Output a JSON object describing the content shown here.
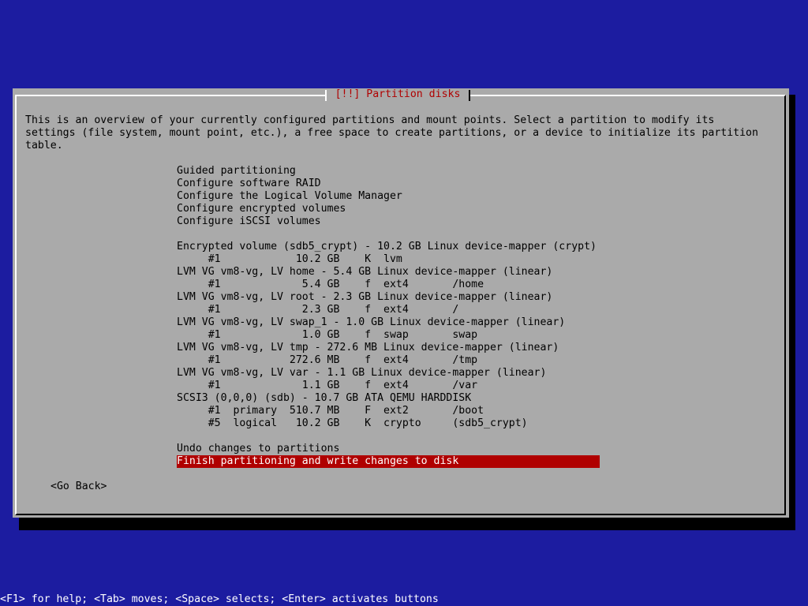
{
  "dialog": {
    "title": "[!!] Partition disks",
    "intro": [
      "This is an overview of your currently configured partitions and mount points. Select a partition to modify its",
      "settings (file system, mount point, etc.), a free space to create partitions, or a device to initialize its partition",
      "table."
    ],
    "actions": [
      "Guided partitioning",
      "Configure software RAID",
      "Configure the Logical Volume Manager",
      "Configure encrypted volumes",
      "Configure iSCSI volumes"
    ],
    "devices": [
      "Encrypted volume (sdb5_crypt) - 10.2 GB Linux device-mapper (crypt)",
      "     #1            10.2 GB    K  lvm",
      "LVM VG vm8-vg, LV home - 5.4 GB Linux device-mapper (linear)",
      "     #1             5.4 GB    f  ext4       /home",
      "LVM VG vm8-vg, LV root - 2.3 GB Linux device-mapper (linear)",
      "     #1             2.3 GB    f  ext4       /",
      "LVM VG vm8-vg, LV swap_1 - 1.0 GB Linux device-mapper (linear)",
      "     #1             1.0 GB    f  swap       swap",
      "LVM VG vm8-vg, LV tmp - 272.6 MB Linux device-mapper (linear)",
      "     #1           272.6 MB    f  ext4       /tmp",
      "LVM VG vm8-vg, LV var - 1.1 GB Linux device-mapper (linear)",
      "     #1             1.1 GB    f  ext4       /var",
      "SCSI3 (0,0,0) (sdb) - 10.7 GB ATA QEMU HARDDISK",
      "     #1  primary  510.7 MB    F  ext2       /boot",
      "     #5  logical   10.2 GB    K  crypto     (sdb5_crypt)"
    ],
    "undo": "Undo changes to partitions",
    "finish": "Finish partitioning and write changes to disk",
    "go_back": "<Go Back>"
  },
  "status_bar": "<F1> for help; <Tab> moves; <Space> selects; <Enter> activates buttons",
  "colors": {
    "background": "#1c1ca0",
    "dialog": "#aaaaaa",
    "highlight": "#b00000",
    "title_text": "#b00000"
  }
}
